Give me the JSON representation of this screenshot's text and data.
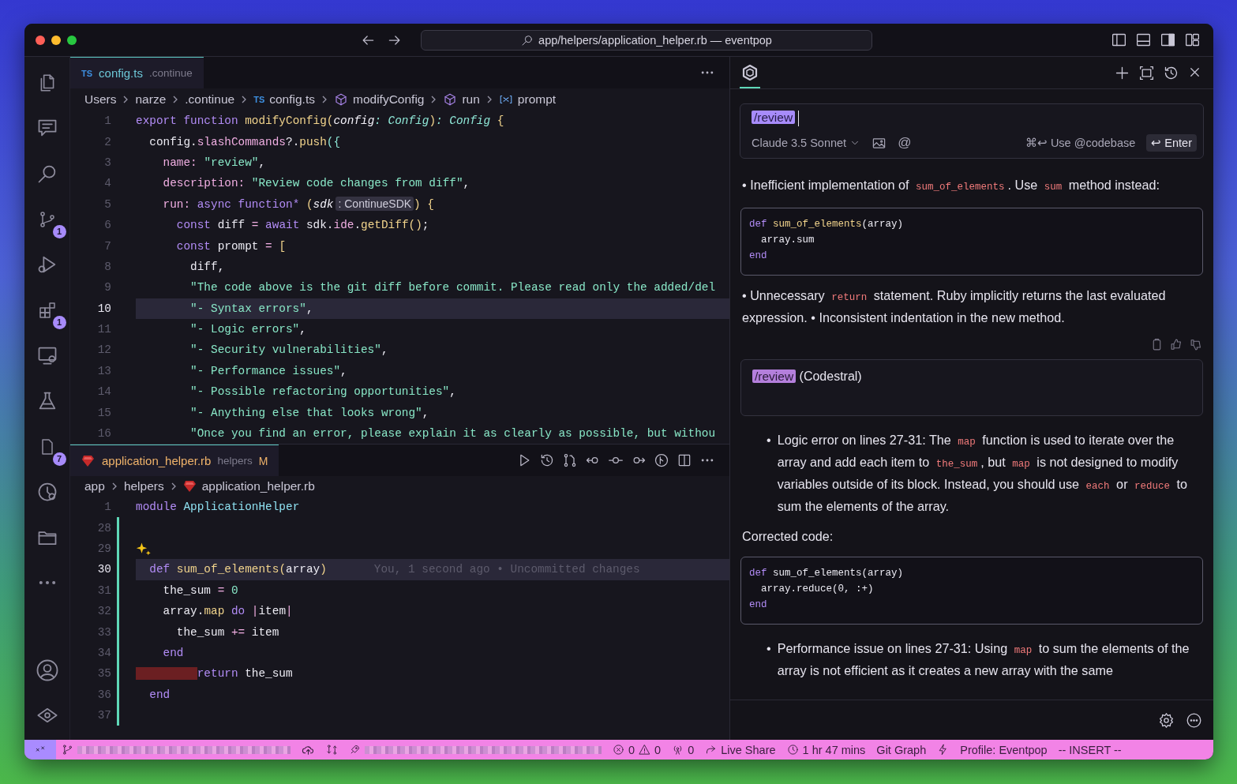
{
  "window": {
    "title": "app/helpers/application_helper.rb — eventpop"
  },
  "activity_bar": {
    "items": [
      {
        "kind": "files"
      },
      {
        "kind": "chat"
      },
      {
        "kind": "search"
      },
      {
        "kind": "source_control",
        "badge": "1"
      },
      {
        "kind": "debug"
      },
      {
        "kind": "extensions",
        "badge": "1"
      },
      {
        "kind": "remote"
      },
      {
        "kind": "testing"
      },
      {
        "kind": "notes",
        "badge": "7"
      },
      {
        "kind": "timeline"
      },
      {
        "kind": "folder"
      },
      {
        "kind": "more"
      }
    ],
    "bottom_items": [
      {
        "kind": "account"
      },
      {
        "kind": "shield"
      }
    ]
  },
  "top_editor": {
    "tab": {
      "kind": "ts",
      "file_badge": "TS",
      "label": "config.ts",
      "description": ".continue",
      "selected": true
    },
    "breadcrumbs": [
      {
        "kind": "folder",
        "text": "Users"
      },
      {
        "kind": "folder",
        "text": "narze"
      },
      {
        "kind": "folder",
        "text": ".continue"
      },
      {
        "kind": "ts",
        "file_badge": "TS",
        "text": "config.ts"
      },
      {
        "kind": "method",
        "text": "modifyConfig"
      },
      {
        "kind": "method",
        "text": "run"
      },
      {
        "kind": "variable",
        "text": "prompt"
      }
    ],
    "lines": [
      {
        "number": "1",
        "current": false,
        "tokens": [
          {
            "text": "export ",
            "kind": "kw"
          },
          {
            "text": "function ",
            "kind": "kw"
          },
          {
            "text": "modifyConfig",
            "kind": "fn"
          },
          {
            "text": "(",
            "kind": "punc"
          },
          {
            "text": "config",
            "kind": "param"
          },
          {
            "text": ": ",
            "kind": "type"
          },
          {
            "text": "Config",
            "kind": "type"
          },
          {
            "text": ")",
            "kind": "punc"
          },
          {
            "text": ": ",
            "kind": "type"
          },
          {
            "text": "Config",
            "kind": "type"
          },
          {
            "text": " {",
            "kind": "punc"
          }
        ]
      },
      {
        "number": "2",
        "current": false,
        "tokens": [
          {
            "text": "  config",
            "kind": "plain"
          },
          {
            "text": ".",
            "kind": "plain"
          },
          {
            "text": "slashCommands",
            "kind": "prop"
          },
          {
            "text": "?.",
            "kind": "plain"
          },
          {
            "text": "push",
            "kind": "fn"
          },
          {
            "text": "({",
            "kind": "brace"
          }
        ]
      },
      {
        "number": "3",
        "current": false,
        "tokens": [
          {
            "text": "    name",
            "kind": "prop"
          },
          {
            "text": ": ",
            "kind": "prop"
          },
          {
            "text": "\"review\"",
            "kind": "str"
          },
          {
            "text": ",",
            "kind": "plain"
          }
        ]
      },
      {
        "number": "4",
        "current": false,
        "tokens": [
          {
            "text": "    description",
            "kind": "prop"
          },
          {
            "text": ": ",
            "kind": "prop"
          },
          {
            "text": "\"Review code changes from diff\"",
            "kind": "str"
          },
          {
            "text": ",",
            "kind": "plain"
          }
        ]
      },
      {
        "number": "5",
        "current": false,
        "tokens": [
          {
            "text": "    run",
            "kind": "prop"
          },
          {
            "text": ": ",
            "kind": "prop"
          },
          {
            "text": "async ",
            "kind": "kw"
          },
          {
            "text": "function* ",
            "kind": "kw"
          },
          {
            "text": "(",
            "kind": "punc"
          },
          {
            "text": "sdk",
            "kind": "param"
          },
          {
            "text": ": ContinueSDK",
            "kind": "hint"
          },
          {
            "text": ")",
            "kind": "punc"
          },
          {
            "text": " {",
            "kind": "punc"
          }
        ]
      },
      {
        "number": "6",
        "current": false,
        "tokens": [
          {
            "text": "      const ",
            "kind": "kw"
          },
          {
            "text": "diff ",
            "kind": "plain"
          },
          {
            "text": "= ",
            "kind": "op"
          },
          {
            "text": "await ",
            "kind": "kw"
          },
          {
            "text": "sdk",
            "kind": "plain"
          },
          {
            "text": ".",
            "kind": "plain"
          },
          {
            "text": "ide",
            "kind": "prop"
          },
          {
            "text": ".",
            "kind": "plain"
          },
          {
            "text": "getDiff",
            "kind": "fn"
          },
          {
            "text": "()",
            "kind": "punc"
          },
          {
            "text": ";",
            "kind": "plain"
          }
        ]
      },
      {
        "number": "7",
        "current": false,
        "tokens": [
          {
            "text": "      const ",
            "kind": "kw"
          },
          {
            "text": "prompt ",
            "kind": "plain"
          },
          {
            "text": "= ",
            "kind": "op"
          },
          {
            "text": "[",
            "kind": "punc"
          }
        ]
      },
      {
        "number": "8",
        "current": false,
        "tokens": [
          {
            "text": "        diff",
            "kind": "plain"
          },
          {
            "text": ",",
            "kind": "plain"
          }
        ]
      },
      {
        "number": "9",
        "current": false,
        "tokens": [
          {
            "text": "        \"The code above is the git diff before commit. Please read only the added/del",
            "kind": "str"
          }
        ]
      },
      {
        "number": "10",
        "current": true,
        "tokens": [
          {
            "text": "        \"- Syntax errors\"",
            "kind": "str"
          },
          {
            "text": ",",
            "kind": "plain"
          }
        ]
      },
      {
        "number": "11",
        "current": false,
        "tokens": [
          {
            "text": "        \"- Logic errors\"",
            "kind": "str"
          },
          {
            "text": ",",
            "kind": "plain"
          }
        ]
      },
      {
        "number": "12",
        "current": false,
        "tokens": [
          {
            "text": "        \"- Security vulnerabilities\"",
            "kind": "str"
          },
          {
            "text": ",",
            "kind": "plain"
          }
        ]
      },
      {
        "number": "13",
        "current": false,
        "tokens": [
          {
            "text": "        \"- Performance issues\"",
            "kind": "str"
          },
          {
            "text": ",",
            "kind": "plain"
          }
        ]
      },
      {
        "number": "14",
        "current": false,
        "tokens": [
          {
            "text": "        \"- Possible refactoring opportunities\"",
            "kind": "str"
          },
          {
            "text": ",",
            "kind": "plain"
          }
        ]
      },
      {
        "number": "15",
        "current": false,
        "tokens": [
          {
            "text": "        \"- Anything else that looks wrong\"",
            "kind": "str"
          },
          {
            "text": ",",
            "kind": "plain"
          }
        ]
      },
      {
        "number": "16",
        "current": false,
        "tokens": [
          {
            "text": "        \"Once you find an error, please explain it as clearly as possible, but withou",
            "kind": "str"
          }
        ]
      }
    ]
  },
  "bottom_editor": {
    "tab": {
      "kind": "ruby",
      "label": "application_helper.rb",
      "description": "helpers",
      "status": "M",
      "selected": true
    },
    "breadcrumbs": [
      {
        "kind": "folder",
        "text": "app"
      },
      {
        "kind": "folder",
        "text": "helpers"
      },
      {
        "kind": "ruby",
        "text": "application_helper.rb"
      }
    ],
    "lines": [
      {
        "number": "1",
        "current": false,
        "modified": false,
        "tokens": [
          {
            "text": "module ",
            "kind": "kw"
          },
          {
            "text": "ApplicationHelper",
            "kind": "cls"
          }
        ]
      },
      {
        "number": "28",
        "current": false,
        "modified": true
      },
      {
        "number": "29",
        "current": false,
        "modified": true,
        "sparkle": true
      },
      {
        "number": "30",
        "current": true,
        "modified": true,
        "blame": "You, 1 second ago • Uncommitted changes",
        "tokens": [
          {
            "text": "  def ",
            "kind": "kw"
          },
          {
            "text": "sum_of_elements",
            "kind": "fn"
          },
          {
            "text": "(",
            "kind": "punc"
          },
          {
            "text": "array",
            "kind": "plain"
          },
          {
            "text": ")",
            "kind": "punc"
          }
        ]
      },
      {
        "number": "31",
        "current": false,
        "modified": true,
        "tokens": [
          {
            "text": "    the_sum ",
            "kind": "plain"
          },
          {
            "text": "= ",
            "kind": "op"
          },
          {
            "text": "0",
            "kind": "num"
          }
        ]
      },
      {
        "number": "32",
        "current": false,
        "modified": true,
        "tokens": [
          {
            "text": "    array",
            "kind": "plain"
          },
          {
            "text": ".",
            "kind": "plain"
          },
          {
            "text": "map ",
            "kind": "fn"
          },
          {
            "text": "do ",
            "kind": "kw"
          },
          {
            "text": "|",
            "kind": "op"
          },
          {
            "text": "item",
            "kind": "plain"
          },
          {
            "text": "|",
            "kind": "op"
          }
        ]
      },
      {
        "number": "33",
        "current": false,
        "modified": true,
        "tokens": [
          {
            "text": "      the_sum ",
            "kind": "plain"
          },
          {
            "text": "+= ",
            "kind": "op"
          },
          {
            "text": "item",
            "kind": "plain"
          }
        ]
      },
      {
        "number": "34",
        "current": false,
        "modified": true,
        "tokens": [
          {
            "text": "    end",
            "kind": "kw"
          }
        ]
      },
      {
        "number": "35",
        "current": false,
        "modified": true,
        "indent_error": true,
        "tokens": [
          {
            "text": "         return ",
            "kind": "kw"
          },
          {
            "text": "the_sum",
            "kind": "plain"
          }
        ]
      },
      {
        "number": "36",
        "current": false,
        "modified": true,
        "tokens": [
          {
            "text": "  end",
            "kind": "kw"
          }
        ]
      },
      {
        "number": "37",
        "current": false,
        "modified": true
      }
    ]
  },
  "chat": {
    "input": {
      "command": "/review",
      "model": "Claude 3.5 Sonnet",
      "mention": "@",
      "hint": "⌘↩ Use @codebase",
      "submit": "↩ Enter"
    },
    "messages": [
      {
        "kind": "paragraph",
        "segments": [
          {
            "kind": "text",
            "text": "• Inefficient implementation of "
          },
          {
            "kind": "code",
            "text": "sum_of_elements"
          },
          {
            "kind": "text",
            "text": ". Use "
          },
          {
            "kind": "code",
            "text": "sum"
          },
          {
            "kind": "text",
            "text": " method instead:"
          }
        ]
      },
      {
        "kind": "code",
        "lines": [
          [
            {
              "text": "def ",
              "kind": "kw"
            },
            {
              "text": "sum_of_elements",
              "kind": "fn"
            },
            {
              "text": "(array)",
              "kind": "plain"
            }
          ],
          [
            {
              "text": "  array.sum",
              "kind": "plain"
            }
          ],
          [
            {
              "text": "end",
              "kind": "kw"
            }
          ]
        ]
      },
      {
        "kind": "paragraph",
        "segments": [
          {
            "kind": "text",
            "text": "• Unnecessary "
          },
          {
            "kind": "code",
            "text": "return"
          },
          {
            "kind": "text",
            "text": " statement. Ruby implicitly returns the last evaluated expression. • Inconsistent indentation in the new method."
          }
        ]
      },
      {
        "kind": "feedback"
      },
      {
        "kind": "user",
        "command": "/review",
        "text": "(Codestral)"
      },
      {
        "kind": "bullets",
        "items": [
          {
            "bullet": "•",
            "segments": [
              {
                "kind": "text",
                "text": "Logic error on lines 27-31: The "
              },
              {
                "kind": "code",
                "text": "map"
              },
              {
                "kind": "text",
                "text": " function is used to iterate over the array and add each item to "
              },
              {
                "kind": "code",
                "text": "the_sum"
              },
              {
                "kind": "text",
                "text": ", but "
              },
              {
                "kind": "code",
                "text": "map"
              },
              {
                "kind": "text",
                "text": " is not designed to modify variables outside of its block. Instead, you should use "
              },
              {
                "kind": "code",
                "text": "each"
              },
              {
                "kind": "text",
                "text": " or "
              },
              {
                "kind": "code",
                "text": "reduce"
              },
              {
                "kind": "text",
                "text": " to sum the elements of the array."
              }
            ]
          }
        ]
      },
      {
        "kind": "paragraph",
        "segments": [
          {
            "kind": "text",
            "text": "Corrected code:"
          }
        ]
      },
      {
        "kind": "code",
        "lines": [
          [
            {
              "text": "def ",
              "kind": "kw"
            },
            {
              "text": "sum_of_elements",
              "kind": "plain"
            },
            {
              "text": "(array)",
              "kind": "plain"
            }
          ],
          [
            {
              "text": "  array.reduce(0, :+)",
              "kind": "plain"
            }
          ],
          [
            {
              "text": "end",
              "kind": "kw"
            }
          ]
        ]
      },
      {
        "kind": "bullets",
        "items": [
          {
            "bullet": "•",
            "segments": [
              {
                "kind": "text",
                "text": "Performance issue on lines 27-31: Using "
              },
              {
                "kind": "code",
                "text": "map"
              },
              {
                "kind": "text",
                "text": " to sum the elements of the array is not efficient as it creates a new array with the same"
              }
            ]
          }
        ]
      }
    ]
  },
  "status_bar": {
    "items": [
      {
        "kind": "remote"
      },
      {
        "kind": "branch"
      },
      {
        "kind": "sync"
      },
      {
        "kind": "compare"
      },
      {
        "kind": "deploy"
      },
      {
        "kind": "problems",
        "errors": "0",
        "warnings": "0"
      },
      {
        "kind": "ports",
        "text": "0"
      },
      {
        "kind": "live_share",
        "text": "Live Share"
      },
      {
        "kind": "timer",
        "text": "1 hr 47 mins"
      },
      {
        "kind": "text",
        "text": "Git Graph"
      },
      {
        "kind": "bolt"
      },
      {
        "kind": "text",
        "text": "Profile: Eventpop"
      },
      {
        "kind": "text",
        "text": "-- INSERT --"
      }
    ]
  }
}
